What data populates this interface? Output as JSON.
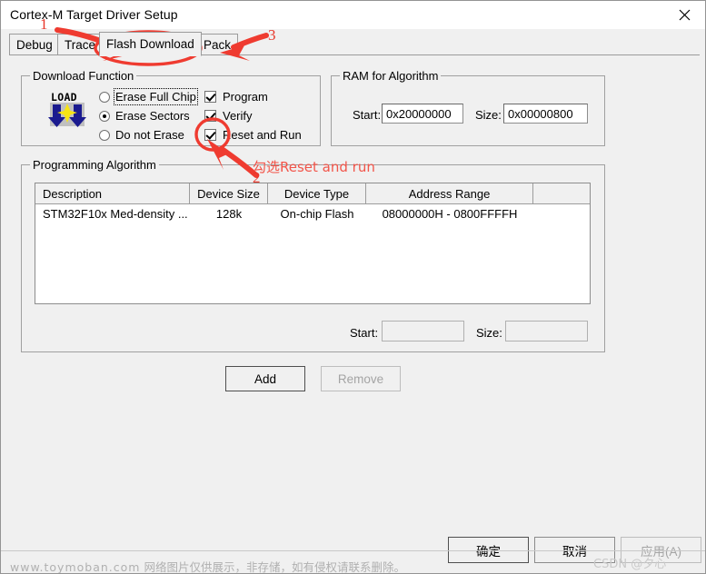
{
  "window": {
    "title": "Cortex-M Target Driver Setup",
    "close_icon": "close-icon"
  },
  "tabs": [
    {
      "label": "Debug",
      "selected": false
    },
    {
      "label": "Trace",
      "selected": false
    },
    {
      "label": "Flash Download",
      "selected": true
    },
    {
      "label": "Pack",
      "selected": false
    }
  ],
  "download_function": {
    "group_label": "Download Function",
    "icon_label": "LOAD",
    "radios": [
      {
        "label": "Erase Full Chip",
        "checked": false,
        "focused": true
      },
      {
        "label": "Erase Sectors",
        "checked": true,
        "focused": false
      },
      {
        "label": "Do not Erase",
        "checked": false,
        "focused": false
      }
    ],
    "checkboxes": [
      {
        "label": "Program",
        "checked": true
      },
      {
        "label": "Verify",
        "checked": true
      },
      {
        "label": "Reset and Run",
        "checked": true
      }
    ]
  },
  "ram_for_algorithm": {
    "group_label": "RAM for Algorithm",
    "start_label": "Start:",
    "start_value": "0x20000000",
    "size_label": "Size:",
    "size_value": "0x00000800"
  },
  "programming_algorithm": {
    "group_label": "Programming Algorithm",
    "columns": [
      "Description",
      "Device Size",
      "Device Type",
      "Address Range",
      ""
    ],
    "rows": [
      {
        "description": "STM32F10x Med-density ...",
        "device_size": "128k",
        "device_type": "On-chip Flash",
        "address_range": "08000000H - 0800FFFFH",
        "extra": ""
      }
    ],
    "start_label": "Start:",
    "start_value": "",
    "size_label": "Size:",
    "size_value": "",
    "add_label": "Add",
    "remove_label": "Remove"
  },
  "dialog_buttons": {
    "ok": "确定",
    "cancel": "取消",
    "apply": "应用(A)"
  },
  "watermark": {
    "url": "www.toymoban.com",
    "notice": "网络图片仅供展示，非存储，如有侵权请联系删除。",
    "csdn": "CSDN @夕心"
  },
  "annotations": {
    "num1": "1",
    "num2": "2",
    "num3": "3",
    "note": "勾选Reset and run",
    "accent_color": "#ef3b30"
  }
}
